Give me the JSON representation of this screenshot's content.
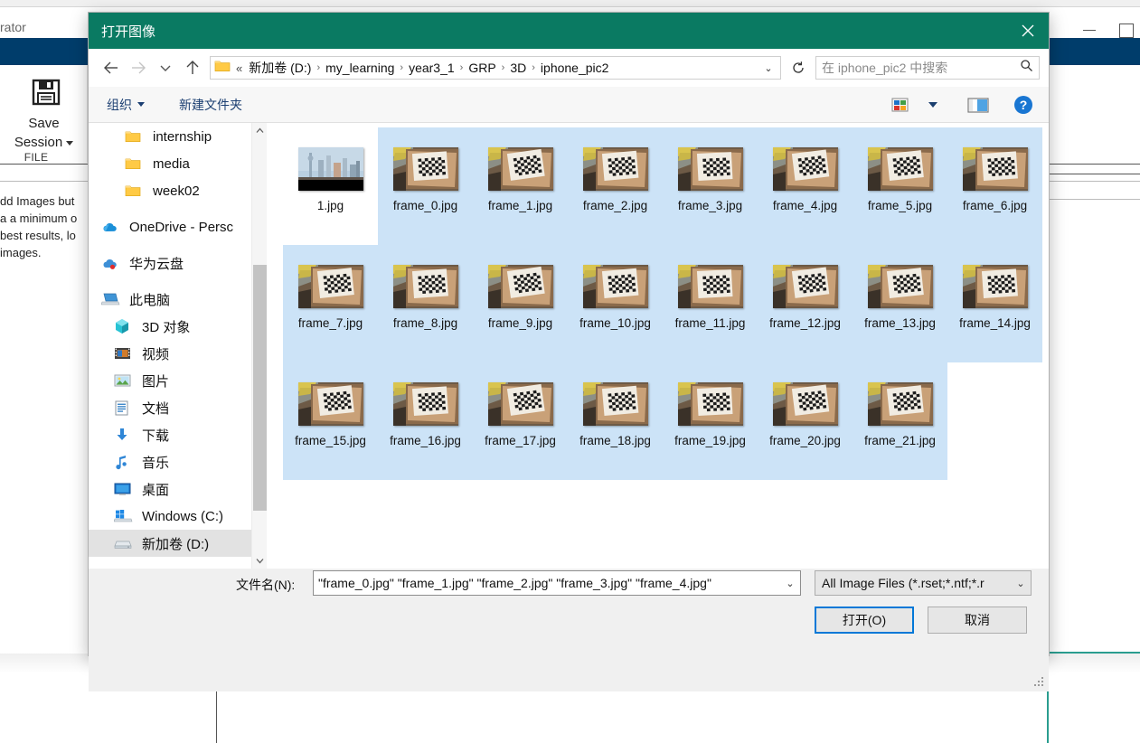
{
  "background_app": {
    "title_fragment": "rator",
    "ribbon_group": {
      "save_icon": "floppy-disk-icon",
      "button_line1": "Save",
      "button_line2": "Session",
      "group_label": "FILE"
    },
    "help_text_lines": [
      "dd Images but",
      "a a minimum o",
      "best results, lo",
      "images."
    ],
    "window_controls": {
      "minimize": "minimize-icon",
      "maximize": "maximize-icon"
    },
    "colors": {
      "ribbon_bar": "#003d6b",
      "accent_line": "#2a9d8f"
    }
  },
  "dialog": {
    "title": "打开图像",
    "close_label": "✕",
    "titlebar_color": "#0a7a62",
    "nav": {
      "back": "←",
      "forward": "→",
      "recent": "⌄",
      "up": "↑",
      "refresh": "↻"
    },
    "address": {
      "folder_icon": "folder-icon",
      "head_chevron": "«",
      "crumbs": [
        "新加卷 (D:)",
        "my_learning",
        "year3_1",
        "GRP",
        "3D",
        "iphone_pic2"
      ],
      "separator": "›",
      "dropdown": "⌄"
    },
    "search": {
      "placeholder": "在 iphone_pic2 中搜索",
      "icon": "search-icon"
    },
    "toolbar": {
      "organize": "组织",
      "new_folder": "新建文件夹",
      "view_icon": "view-options-icon",
      "view_caret": "⌄",
      "preview_pane_icon": "preview-pane-icon",
      "help_icon": "help-icon",
      "help_glyph": "?"
    },
    "nav_pane": {
      "items": [
        {
          "label": "internship",
          "icon": "folder-icon",
          "indent": 1,
          "selected": false
        },
        {
          "label": "media",
          "icon": "folder-icon",
          "indent": 1,
          "selected": false
        },
        {
          "label": "week02",
          "icon": "folder-icon",
          "indent": 1,
          "selected": false
        },
        {
          "label": "OneDrive - Persc",
          "icon": "onedrive-icon",
          "indent": 0,
          "selected": false
        },
        {
          "label": "华为云盘",
          "icon": "huawei-cloud-icon",
          "indent": 0,
          "selected": false
        },
        {
          "label": "此电脑",
          "icon": "this-pc-icon",
          "indent": 0,
          "selected": false
        },
        {
          "label": "3D 对象",
          "icon": "3d-objects-icon",
          "indent": 2,
          "selected": false
        },
        {
          "label": "视频",
          "icon": "videos-icon",
          "indent": 2,
          "selected": false
        },
        {
          "label": "图片",
          "icon": "pictures-icon",
          "indent": 2,
          "selected": false
        },
        {
          "label": "文档",
          "icon": "documents-icon",
          "indent": 2,
          "selected": false
        },
        {
          "label": "下载",
          "icon": "downloads-icon",
          "indent": 2,
          "selected": false
        },
        {
          "label": "音乐",
          "icon": "music-icon",
          "indent": 2,
          "selected": false
        },
        {
          "label": "桌面",
          "icon": "desktop-icon",
          "indent": 2,
          "selected": false
        },
        {
          "label": "Windows (C:)",
          "icon": "windows-drive-icon",
          "indent": 2,
          "selected": false
        },
        {
          "label": "新加卷 (D:)",
          "icon": "drive-icon",
          "indent": 2,
          "selected": true
        }
      ],
      "scrollbar": {
        "up_arrow": "⌃",
        "down_arrow": "⌄"
      }
    },
    "files": [
      {
        "name": "1.jpg",
        "thumb": "city-skyline",
        "selected": false
      },
      {
        "name": "frame_0.jpg",
        "thumb": "checkerboard",
        "selected": true
      },
      {
        "name": "frame_1.jpg",
        "thumb": "checkerboard",
        "selected": true
      },
      {
        "name": "frame_2.jpg",
        "thumb": "checkerboard",
        "selected": true
      },
      {
        "name": "frame_3.jpg",
        "thumb": "checkerboard",
        "selected": true
      },
      {
        "name": "frame_4.jpg",
        "thumb": "checkerboard",
        "selected": true
      },
      {
        "name": "frame_5.jpg",
        "thumb": "checkerboard",
        "selected": true
      },
      {
        "name": "frame_6.jpg",
        "thumb": "checkerboard",
        "selected": true
      },
      {
        "name": "frame_7.jpg",
        "thumb": "checkerboard",
        "selected": true
      },
      {
        "name": "frame_8.jpg",
        "thumb": "checkerboard",
        "selected": true
      },
      {
        "name": "frame_9.jpg",
        "thumb": "checkerboard",
        "selected": true
      },
      {
        "name": "frame_10.jpg",
        "thumb": "checkerboard",
        "selected": true
      },
      {
        "name": "frame_11.jpg",
        "thumb": "checkerboard",
        "selected": true
      },
      {
        "name": "frame_12.jpg",
        "thumb": "checkerboard",
        "selected": true
      },
      {
        "name": "frame_13.jpg",
        "thumb": "checkerboard",
        "selected": true
      },
      {
        "name": "frame_14.jpg",
        "thumb": "checkerboard",
        "selected": true
      },
      {
        "name": "frame_15.jpg",
        "thumb": "checkerboard",
        "selected": true
      },
      {
        "name": "frame_16.jpg",
        "thumb": "checkerboard",
        "selected": true
      },
      {
        "name": "frame_17.jpg",
        "thumb": "checkerboard",
        "selected": true
      },
      {
        "name": "frame_18.jpg",
        "thumb": "checkerboard",
        "selected": true
      },
      {
        "name": "frame_19.jpg",
        "thumb": "checkerboard",
        "selected": true
      },
      {
        "name": "frame_20.jpg",
        "thumb": "checkerboard",
        "selected": true
      },
      {
        "name": "frame_21.jpg",
        "thumb": "checkerboard",
        "selected": true
      }
    ],
    "footer": {
      "filename_label": "文件名(N):",
      "filename_value": "\"frame_0.jpg\" \"frame_1.jpg\" \"frame_2.jpg\" \"frame_3.jpg\" \"frame_4.jpg\"",
      "filename_caret": "⌄",
      "filetype_value": "All Image Files (*.rset;*.ntf;*.r",
      "filetype_caret": "⌄",
      "open_button": "打开(O)",
      "cancel_button": "取消",
      "focus_color": "#0078d7"
    }
  }
}
